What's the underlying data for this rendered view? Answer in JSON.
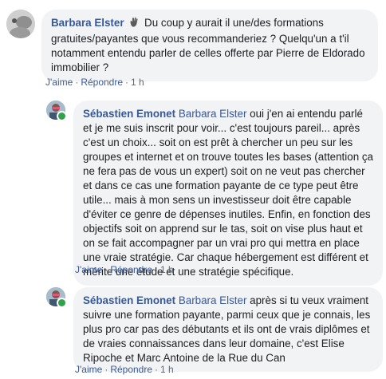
{
  "comments": [
    {
      "author": "Barbara Elster",
      "mention": "",
      "text": "Du coup y aurait il une/des formations gratuites/payantes que vous recommanderiez ? Quelqu'un a t'il notamment entendu parler de celles offerte par Pierre de Eldorado immobilier ?",
      "like_label": "J'aime",
      "reply_label": "Répondre",
      "time": "1 h"
    },
    {
      "author": "Sébastien Emonet",
      "mention": "Barbara Elster",
      "text": "oui j'en ai entendu parlé et je me suis inscrit pour voir... c'est toujours pareil... après c'est un choix... soit on est prêt à chercher un peu sur les groupes et internet et on trouve toutes les bases (attention ça ne fera pas de vous un expert) soit on ne veut pas chercher et dans ce cas une formation payante de ce type peut être utile... mais à mon sens un investisseur doit être capable d'éviter ce genre de dépenses inutiles. Enfin, en fonction des objectifs soit on apprend sur le tas, soit on vise plus haut et on se fait accompagner par un vrai pro qui mettra en place une vraie stratégie. Car chaque hébergement est différent et mérite une étude et une stratégie spécifique.",
      "like_label": "J'aime",
      "reply_label": "Répondre",
      "time": "1 h"
    },
    {
      "author": "Sébastien Emonet",
      "mention": "Barbara Elster",
      "text": "après si tu veux vraiment suivre une formation payante, parmi ceux que je connais, les plus pro car pas des débutants et ils ont de vrais diplômes et de vraies connaissances dans leur domaine, c'est Elise Ripoche et Marc Antoine de la Rue du Can",
      "like_label": "J'aime",
      "reply_label": "Répondre",
      "time": "1 h"
    }
  ],
  "icons": {
    "avatar_barbara": "user-avatar",
    "avatar_sebastien": "user-avatar",
    "online": "online-status-dot",
    "emoji": "waving-hand-emoji"
  },
  "colors": {
    "link": "#385898",
    "bubble": "#f2f3f5",
    "online": "#31a24c"
  }
}
